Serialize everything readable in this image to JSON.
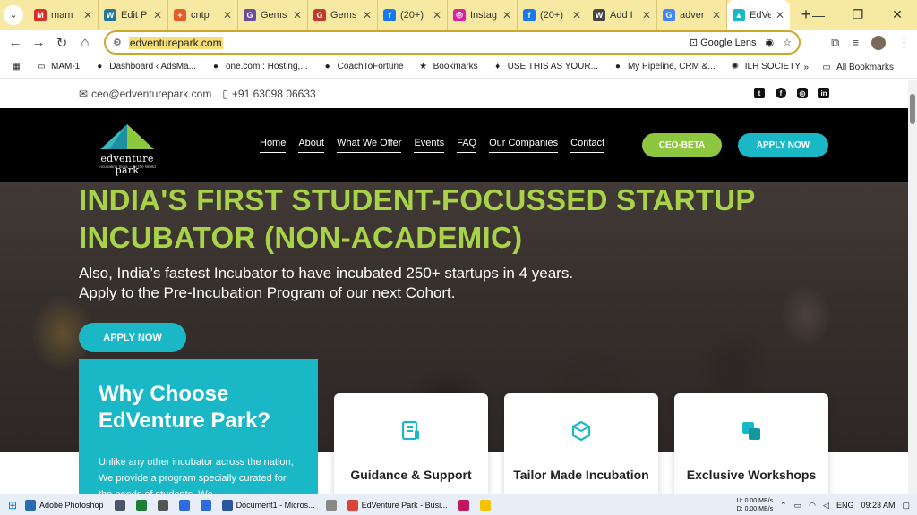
{
  "browser": {
    "tabs": [
      {
        "label": "mam",
        "icon": "gmail-icon",
        "color": "#d93025",
        "glyph": "M"
      },
      {
        "label": "Edit P",
        "icon": "wordpress-icon",
        "color": "#21759b",
        "glyph": "W"
      },
      {
        "label": "cntp",
        "icon": "page-icon",
        "color": "#e35d2b",
        "glyph": "+"
      },
      {
        "label": "Gems",
        "icon": "gems-icon",
        "color": "#6a4c9c",
        "glyph": "G"
      },
      {
        "label": "Gems",
        "icon": "gems-icon",
        "color": "#c0392b",
        "glyph": "G"
      },
      {
        "label": "(20+)",
        "icon": "facebook-icon",
        "color": "#1877f2",
        "glyph": "f"
      },
      {
        "label": "Instag",
        "icon": "instagram-icon",
        "color": "#d6249f",
        "glyph": "◎"
      },
      {
        "label": "(20+)",
        "icon": "facebook-icon",
        "color": "#1877f2",
        "glyph": "f"
      },
      {
        "label": "Add I",
        "icon": "wordpress-icon",
        "color": "#444444",
        "glyph": "W"
      },
      {
        "label": "adver",
        "icon": "google-icon",
        "color": "#4285f4",
        "glyph": "G"
      },
      {
        "label": "EdVer",
        "icon": "edventure-icon",
        "color": "#1ab8c6",
        "glyph": "▲",
        "active": true
      }
    ],
    "url": "edventurepark.com",
    "google_lens": "Google Lens",
    "bookmarks": [
      {
        "label": "MAM-1",
        "icon": "folder-icon",
        "glyph": "▭"
      },
      {
        "label": "Dashboard ‹ AdsMa...",
        "icon": "wordpress-icon",
        "glyph": "●"
      },
      {
        "label": "one.com : Hosting,...",
        "icon": "onecom-icon",
        "glyph": "●"
      },
      {
        "label": "CoachToFortune",
        "icon": "wordpress-icon",
        "glyph": "●"
      },
      {
        "label": "Bookmarks",
        "icon": "star-icon",
        "glyph": "★"
      },
      {
        "label": "USE THIS AS YOUR...",
        "icon": "bookmark-icon",
        "glyph": "♦"
      },
      {
        "label": "My Pipeline, CRM &...",
        "icon": "crm-icon",
        "glyph": "●"
      },
      {
        "label": "ILH SOCIETY",
        "icon": "society-icon",
        "glyph": "✺"
      }
    ],
    "all_bookmarks": "All Bookmarks"
  },
  "site": {
    "email": "ceo@edventurepark.com",
    "phone": "+91 63098 06633",
    "social": [
      "twitter-icon",
      "facebook-icon",
      "instagram-icon",
      "linkedin-icon"
    ],
    "logo_text": "edventure park",
    "logo_tagline": "Incubating India – for the World",
    "nav": [
      "Home",
      "About",
      "What We Offer",
      "Events",
      "FAQ",
      "Our Companies",
      "Contact"
    ],
    "ceo_button": "CEO-BETA",
    "apply_button": "APPLY NOW",
    "hero_title": "INDIA'S FIRST STUDENT-FOCUSSED STARTUP INCUBATOR (NON-ACADEMIC)",
    "hero_sub_1": "Also, India’s fastest Incubator to have incubated 250+ startups in 4 years.",
    "hero_sub_2": "Apply to the Pre-Incubation Program of our next Cohort.",
    "hero_apply": "APPLY NOW",
    "why_title": "Why Choose EdVenture Park?",
    "why_body": "Unlike any other incubator across the nation, We provide a program specially curated for the needs of students. We",
    "cards": [
      {
        "title": "Guidance & Support",
        "icon": "document-icon"
      },
      {
        "title": "Tailor Made Incubation",
        "icon": "hexagon-icon"
      },
      {
        "title": "Exclusive Workshops",
        "icon": "squares-icon"
      }
    ],
    "colors": {
      "green": "#a8d349",
      "teal": "#1ab8c6",
      "ceo": "#8dc63f"
    }
  },
  "taskbar": {
    "items": [
      {
        "label": "Adobe Photoshop",
        "color": "#2b6cb0"
      },
      {
        "label": "",
        "color": "#4a5568"
      },
      {
        "label": "",
        "color": "#1e7e34"
      },
      {
        "label": "",
        "color": "#555555"
      },
      {
        "label": "",
        "color": "#2d6cdf"
      },
      {
        "label": "",
        "color": "#2d6cdf"
      },
      {
        "label": "Document1 - Micros...",
        "color": "#2b579a"
      },
      {
        "label": "",
        "color": "#888888"
      },
      {
        "label": "EdVenture Park - Busi...",
        "color": "#db4437"
      },
      {
        "label": "",
        "color": "#c2185b"
      },
      {
        "label": "",
        "color": "#f5c400"
      }
    ],
    "net_up": "0.00 MB/s",
    "net_down": "0.00 MB/s",
    "net_u": "U:",
    "net_d": "D:",
    "lang": "ENG",
    "time": "09:23 AM"
  }
}
